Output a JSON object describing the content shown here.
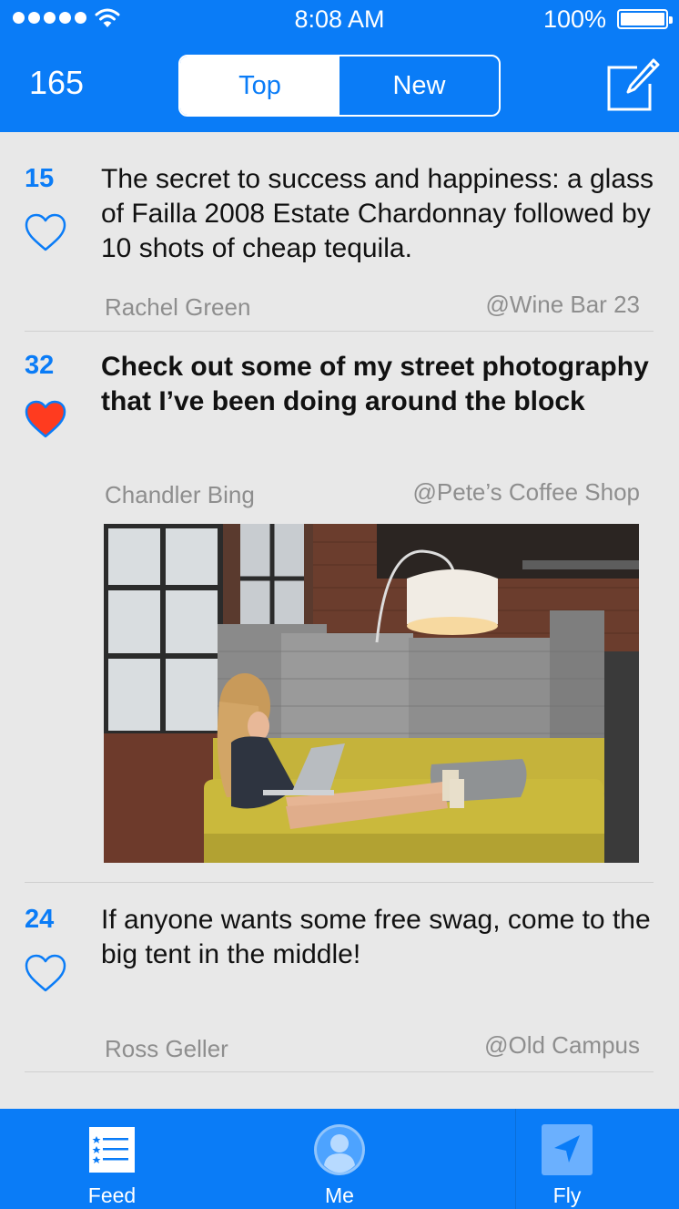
{
  "status": {
    "time": "8:08 AM",
    "battery": "100%"
  },
  "header": {
    "count": "165",
    "tabs": [
      "Top",
      "New"
    ],
    "active_tab": "Top",
    "compose_icon": "compose-icon"
  },
  "posts": [
    {
      "likes": "15",
      "liked": false,
      "text": "The secret to success and happiness: a glass of Failla 2008 Estate Chardonnay followed by 10 shots of cheap tequila.",
      "author": "Rachel Green",
      "location": "@Wine Bar 23"
    },
    {
      "likes": "32",
      "liked": true,
      "text": "Check out some of my street photography that I’ve been doing around the block",
      "author": "Chandler Bing",
      "location": "@Pete’s Coffee Shop",
      "has_photo": true
    },
    {
      "likes": "24",
      "liked": false,
      "text": "If anyone wants some free swag, come to the big tent in the middle!",
      "author": "Ross Geller",
      "location": "@Old Campus"
    }
  ],
  "tabbar": {
    "items": [
      "Feed",
      "Me",
      "Fly"
    ]
  },
  "colors": {
    "accent": "#0a7cf7",
    "heart_liked": "#ff3b1f",
    "muted_text": "#8e8e8e",
    "background": "#e8e8e8"
  }
}
